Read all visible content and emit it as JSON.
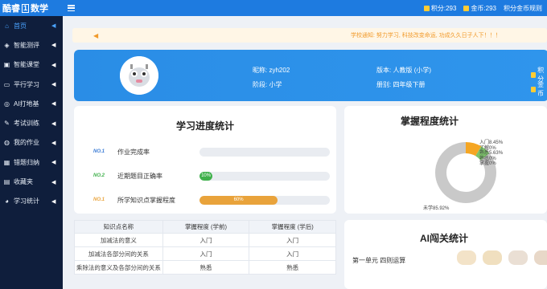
{
  "brand": {
    "prefix": "酷睿",
    "box": "1",
    "subject": "数学"
  },
  "topbar": {
    "points_label": "积分:293",
    "coins_label": "金币:293",
    "rules_label": "积分金币规则"
  },
  "sidebar": {
    "items": [
      {
        "label": "首页",
        "icon": "home-icon",
        "glyph": "⌂"
      },
      {
        "label": "智能测评",
        "icon": "layers-icon",
        "glyph": "◈"
      },
      {
        "label": "智能课堂",
        "icon": "classroom-icon",
        "glyph": "▣"
      },
      {
        "label": "平行学习",
        "icon": "monitor-icon",
        "glyph": "▭"
      },
      {
        "label": "AI打地基",
        "icon": "ai-icon",
        "glyph": "◎"
      },
      {
        "label": "考试训练",
        "icon": "exam-icon",
        "glyph": "✎"
      },
      {
        "label": "我的作业",
        "icon": "homework-icon",
        "glyph": "◍"
      },
      {
        "label": "错题归纳",
        "icon": "wrong-book-icon",
        "glyph": "▦"
      },
      {
        "label": "收藏夹",
        "icon": "folder-icon",
        "glyph": "▤"
      },
      {
        "label": "学习统计",
        "icon": "stats-icon",
        "glyph": "◕"
      }
    ]
  },
  "notice": {
    "text": "学校通知: 努力学习, 科技改变命运, 功成久久日子人下！！！"
  },
  "profile": {
    "nickname_label": "昵称:",
    "nickname_value": "zyh202",
    "grade_label": "阶段:",
    "grade_value": "小学",
    "version_label": "版本:",
    "version_value": "人教版 (小学)",
    "volume_label": "册别:",
    "volume_value": "四年级下册",
    "btn_points": "积分",
    "btn_coins": "金币"
  },
  "progress": {
    "title": "学习进度统计",
    "rows": [
      {
        "no": "NO.1",
        "label": "作业完成率",
        "value": 0,
        "display": "",
        "color": "#f2c73b",
        "no_color": "#3a7bd5"
      },
      {
        "no": "NO.2",
        "label": "近期题目正确率",
        "value": 10,
        "display": "10%",
        "color": "#3fb04b",
        "no_color": "#3fb04b"
      },
      {
        "no": "NO.1",
        "label": "所学知识点掌握程度",
        "value": 60,
        "display": "60%",
        "color": "#e9a33b",
        "no_color": "#e9a33b"
      }
    ]
  },
  "mastery": {
    "title": "掌握程度统计",
    "legend": [
      {
        "name": "入门",
        "value": "8.45%"
      },
      {
        "name": "了解",
        "value": "0%"
      },
      {
        "name": "熟悉",
        "value": "5.63%"
      },
      {
        "name": "熟练",
        "value": "0%"
      },
      {
        "name": "掌握",
        "value": "0%"
      }
    ],
    "unlearned_label": "未学85.92%"
  },
  "chart_data": {
    "type": "pie",
    "title": "掌握程度统计",
    "categories": [
      "入门",
      "了解",
      "熟悉",
      "熟练",
      "掌握",
      "未学"
    ],
    "values": [
      8.45,
      0,
      5.63,
      0,
      0,
      85.92
    ],
    "colors": [
      "#f5a623",
      "#f5d44a",
      "#7cc36a",
      "#3b82c4",
      "#1f5fa8",
      "#c9c9c9"
    ],
    "donut": true
  },
  "table": {
    "headers": [
      "知识点名称",
      "掌握程度 (学前)",
      "掌握程度 (学后)"
    ],
    "rows": [
      {
        "name": "加减法的意义",
        "before": "入门",
        "after": "入门",
        "before_cls": "lv-intro",
        "after_cls": "lv-intro-g"
      },
      {
        "name": "加减法各部分间的关系",
        "before": "入门",
        "after": "入门",
        "before_cls": "lv-intro",
        "after_cls": "lv-intro-g"
      },
      {
        "name": "乘除法的意义及各部分间的关系",
        "before": "熟悉",
        "after": "熟悉",
        "before_cls": "lv-fam",
        "after_cls": "lv-fam-g"
      }
    ]
  },
  "ai": {
    "title": "AI闯关统计",
    "unit": "第一单元 四则运算"
  }
}
